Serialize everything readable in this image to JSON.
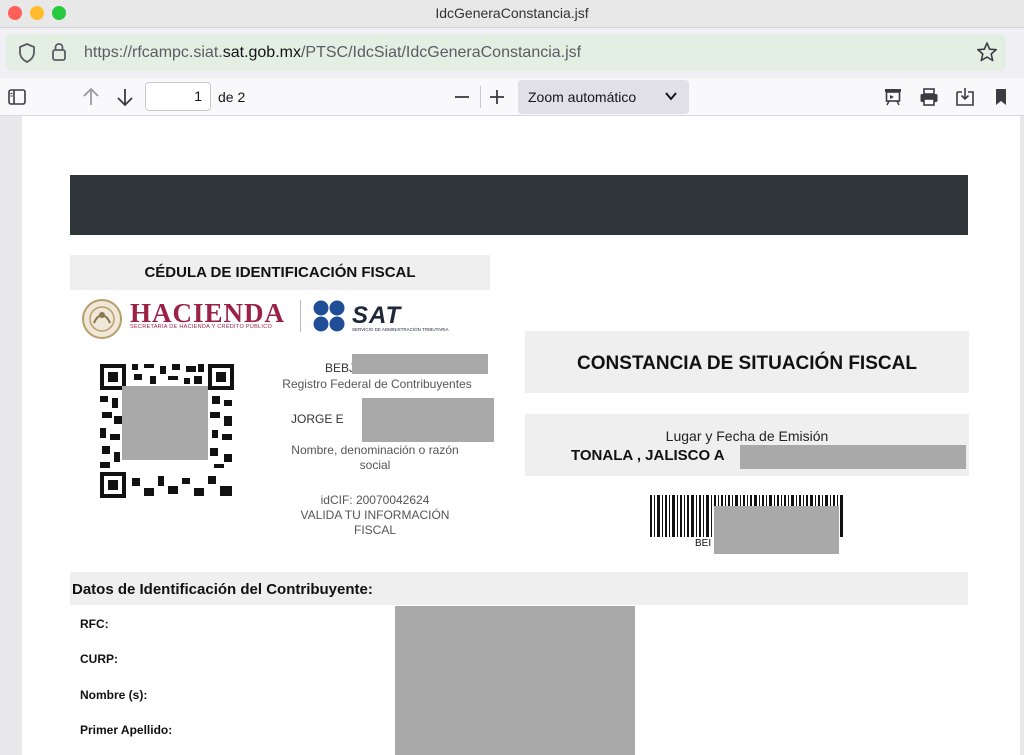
{
  "window": {
    "title": "IdcGeneraConstancia.jsf"
  },
  "address_bar": {
    "url_prefix": "https://rfcampc.siat.",
    "url_domain": "sat.gob.mx",
    "url_path": "/PTSC/IdcSiat/IdcGeneraConstancia.jsf"
  },
  "pdf_toolbar": {
    "current_page": "1",
    "page_of": "de 2",
    "zoom_label": "Zoom automático"
  },
  "document": {
    "cedula_title": "CÉDULA DE IDENTIFICACIÓN FISCAL",
    "hacienda_logo_text": "HACIENDA",
    "hacienda_sub": "SECRETARÍA DE HACIENDA Y CRÉDITO PÚBLICO",
    "sat_logo_text": "SAT",
    "sat_sub": "SERVICIO DE ADMINISTRACIÓN TRIBUTARIA",
    "rfc_partial": "BEBJ",
    "rfc_caption": "Registro Federal de Contribuyentes",
    "name_partial": "JORGE E",
    "name_caption_line1": "Nombre, denominación o razón",
    "name_caption_line2": "social",
    "idcif": "idCIF: 20070042624",
    "valida_line1": "VALIDA TU INFORMACIÓN",
    "valida_line2": "FISCAL",
    "constancia_title": "CONSTANCIA DE SITUACIÓN FISCAL",
    "lugar_label": "Lugar y Fecha de Emisión",
    "lugar_value": "TONALA , JALISCO A",
    "barcode_text": "BEI",
    "datos_title": "Datos de Identificación del Contribuyente:",
    "fields": {
      "rfc": "RFC:",
      "curp": "CURP:",
      "nombre": "Nombre (s):",
      "primer_apellido": "Primer Apellido:"
    }
  }
}
